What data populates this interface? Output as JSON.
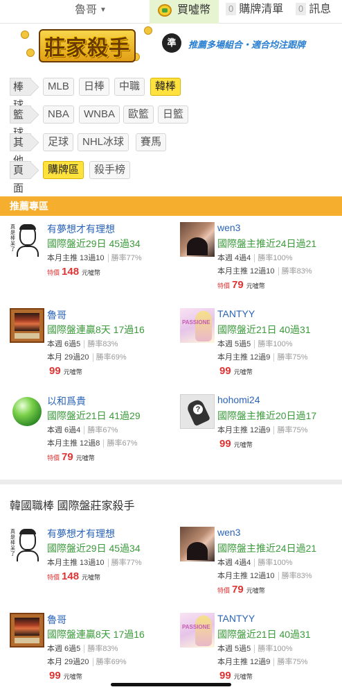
{
  "topbar": {
    "user": "魯哥",
    "coins_label": "買噓幣",
    "cart_count": "0",
    "cart_label": "購牌清單",
    "msg_count": "0",
    "msg_label": "訊息"
  },
  "banner": {
    "logo_text": "莊家殺手",
    "logo_badge": "準",
    "slogan": "推薦多場組合・適合均注跟牌"
  },
  "categories": [
    {
      "head": "棒球",
      "chips": [
        "MLB",
        "日棒",
        "中職",
        "韓棒"
      ],
      "active": "韓棒"
    },
    {
      "head": "籃球",
      "chips": [
        "NBA",
        "WNBA",
        "歐籃",
        "日籃"
      ],
      "active": ""
    },
    {
      "head": "其他",
      "chips": [
        "足球",
        "NHL冰球",
        "賽馬"
      ],
      "active": ""
    },
    {
      "head": "頁面",
      "chips": [
        "購牌區",
        "殺手榜"
      ],
      "active": "購牌區"
    }
  ],
  "recommended": {
    "title": "推薦專區",
    "cards": [
      {
        "avatar": "face-sketch-avatar",
        "avatar_text": "真是棒呆了",
        "name": "有夢想才有理想",
        "record": "國際盤近29日 45過34",
        "line1": "本月主推 13過10",
        "line1_rate": "勝率77%",
        "line2": "",
        "line2_rate": "",
        "special": "特價",
        "price": "148",
        "unit": "元噓幣"
      },
      {
        "avatar": "woman-photo-avatar",
        "avatar_text": "",
        "name": "wen3",
        "record": "國際盤主推近24日過21",
        "line1": "本週 4過4",
        "line1_rate": "勝率100%",
        "line2": "本月主推 12過10",
        "line2_rate": "勝率83%",
        "special": "特價",
        "price": "79",
        "unit": "元噓幣"
      },
      {
        "avatar": "card-art-avatar",
        "avatar_text": "",
        "name": "魯哥",
        "record": "國際盤連贏8天 17過16",
        "line1": "本週 6過5",
        "line1_rate": "勝率83%",
        "line2": "本月 29過20",
        "line2_rate": "勝率69%",
        "special": "",
        "price": "99",
        "unit": "元噓幣"
      },
      {
        "avatar": "anime-girl-avatar",
        "avatar_text": "PASSIONE",
        "name": "TANTYY",
        "record": "國際盤近21日 40過31",
        "line1": "本週 5過5",
        "line1_rate": "勝率100%",
        "line2": "本月主推 12過9",
        "line2_rate": "勝率75%",
        "special": "",
        "price": "99",
        "unit": "元噓幣"
      },
      {
        "avatar": "globe-avatar",
        "avatar_text": "",
        "name": "以和爲貴",
        "record": "國際盤近21日 41過29",
        "line1": "本週 6過4",
        "line1_rate": "勝率67%",
        "line2": "本月主推 12過8",
        "line2_rate": "勝率67%",
        "special": "特價",
        "price": "79",
        "unit": "元噓幣"
      },
      {
        "avatar": "unknown-user-avatar",
        "avatar_text": "?",
        "name": "hohomi24",
        "record": "國際盤主推近20日過17",
        "line1": "本月主推 12過9",
        "line1_rate": "勝率75%",
        "line2": "",
        "line2_rate": "",
        "special": "",
        "price": "99",
        "unit": "元噓幣"
      }
    ]
  },
  "korea": {
    "title": "韓國職棒 國際盤莊家殺手",
    "cards": [
      {
        "avatar": "face-sketch-avatar",
        "avatar_text": "真是棒呆了",
        "name": "有夢想才有理想",
        "record": "國際盤近29日 45過34",
        "line1": "本月主推 13過10",
        "line1_rate": "勝率77%",
        "line2": "",
        "line2_rate": "",
        "special": "特價",
        "price": "148",
        "unit": "元噓幣"
      },
      {
        "avatar": "woman-photo-avatar",
        "avatar_text": "",
        "name": "wen3",
        "record": "國際盤主推近24日過21",
        "line1": "本週 4過4",
        "line1_rate": "勝率100%",
        "line2": "本月主推 12過10",
        "line2_rate": "勝率83%",
        "special": "特價",
        "price": "79",
        "unit": "元噓幣"
      },
      {
        "avatar": "card-art-avatar",
        "avatar_text": "",
        "name": "魯哥",
        "record": "國際盤連贏8天 17過16",
        "line1": "本週 6過5",
        "line1_rate": "勝率83%",
        "line2": "本月 29過20",
        "line2_rate": "勝率69%",
        "special": "",
        "price": "99",
        "unit": "元噓幣"
      },
      {
        "avatar": "anime-girl-avatar",
        "avatar_text": "PASSIONE",
        "name": "TANTYY",
        "record": "國際盤近21日 40過31",
        "line1": "本週 5過5",
        "line1_rate": "勝率100%",
        "line2": "本月主推 12過9",
        "line2_rate": "勝率75%",
        "special": "",
        "price": "99",
        "unit": "元噓幣"
      }
    ]
  },
  "colors": {
    "accent_yellow": "#ffe23e",
    "section_orange": "#f5ae2d",
    "name_blue": "#2a63b8",
    "record_green": "#3a9a3a",
    "price_red": "#d33333"
  }
}
